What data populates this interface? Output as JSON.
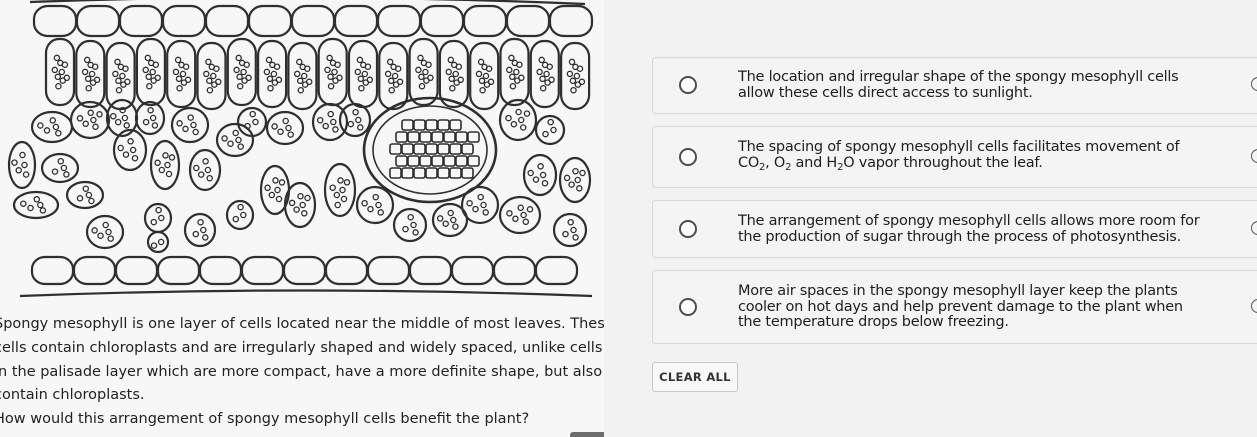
{
  "question": {
    "passage_lines": [
      "Spongy mesophyll is one layer of cells located near the middle of most leaves. These",
      "cells contain chloroplasts and are irregularly shaped and widely spaced, unlike cells",
      "in the palisade layer which are more compact, have a more definite shape, but also",
      "contain chloroplasts."
    ],
    "prompt": "How would this arrangement of spongy mesophyll cells benefit the plant?"
  },
  "figure": {
    "description_icon": "leaf-cross-section-illustration"
  },
  "choices": [
    {
      "line1": "The location and irregular shape of the spongy mesophyll cells",
      "line2": "allow these cells direct access to sunlight.",
      "selected": false
    },
    {
      "line1": "The spacing of spongy mesophyll cells facilitates movement of",
      "line2_parts": {
        "co": "CO",
        "co_sub": "2",
        "comma": ", O",
        "o_sub": "2",
        "and_h": " and H",
        "h_sub": "2",
        "rest": "O vapor throughout the leaf."
      },
      "selected": false
    },
    {
      "line1": "The arrangement of spongy mesophyll cells allows more room for",
      "line2": "the production of sugar through the process of photosynthesis.",
      "selected": false
    },
    {
      "line1": "More air spaces in the spongy mesophyll layer keep the plants",
      "line2": "cooler on hot days and help prevent damage to the plant when",
      "line3": "the temperature drops below freezing.",
      "selected": false
    }
  ],
  "clear_button": "CLEAR ALL"
}
